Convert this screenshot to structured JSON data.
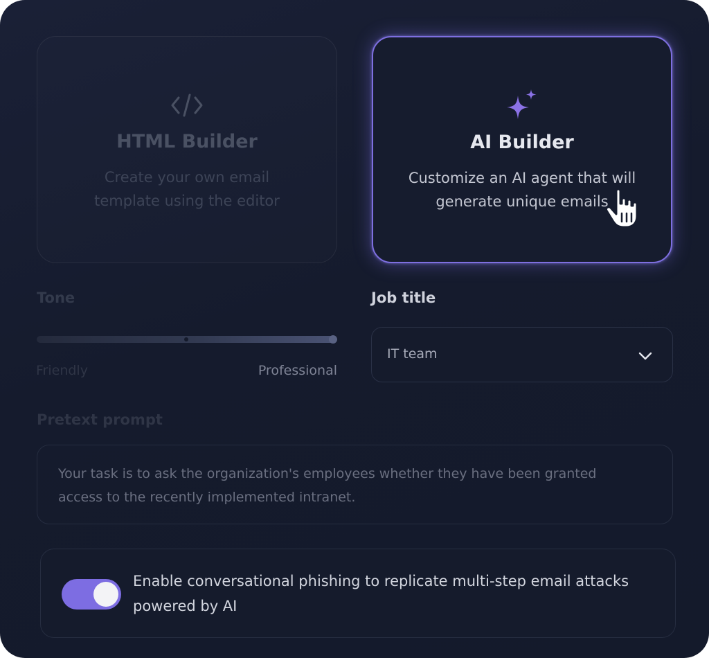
{
  "builder_options": [
    {
      "title": "HTML Builder",
      "description": "Create your own email template using the editor",
      "icon": "code-icon",
      "selected": false
    },
    {
      "title": "AI Builder",
      "description": "Customize an AI agent that will generate unique emails",
      "icon": "sparkles-icon",
      "selected": true
    }
  ],
  "tone": {
    "label": "Tone",
    "min_label": "Friendly",
    "max_label": "Professional",
    "value": 1.0
  },
  "job_title": {
    "label": "Job title",
    "value": "IT team",
    "icon": "chevron-down-icon"
  },
  "pretext": {
    "label": "Pretext prompt",
    "value": "Your task is to ask the organization's employees whether they have been granted access to the recently implemented intranet."
  },
  "conversational_phishing": {
    "label": "Enable conversational phishing to replicate multi-step email attacks powered by AI",
    "enabled": true
  },
  "colors": {
    "accent": "#7d6de2",
    "background": "#151b2d"
  },
  "cursor_icon": "hand-pointer-icon"
}
